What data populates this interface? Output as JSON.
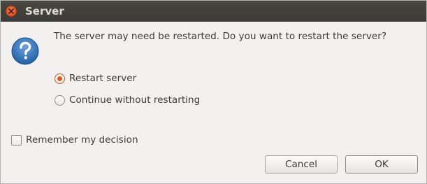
{
  "window": {
    "title": "Server"
  },
  "dialog": {
    "icon": "question-icon",
    "message": "The server may need be restarted. Do you want to restart the server?",
    "options": [
      {
        "label": "Restart server",
        "selected": true
      },
      {
        "label": "Continue without restarting",
        "selected": false
      }
    ],
    "remember": {
      "label": "Remember my decision",
      "checked": false
    }
  },
  "buttons": {
    "cancel_label": "Cancel",
    "ok_label": "OK"
  },
  "colors": {
    "titlebar": "#3c3b37",
    "accent": "#e05b22",
    "icon_blue": "#2a6fb8"
  }
}
